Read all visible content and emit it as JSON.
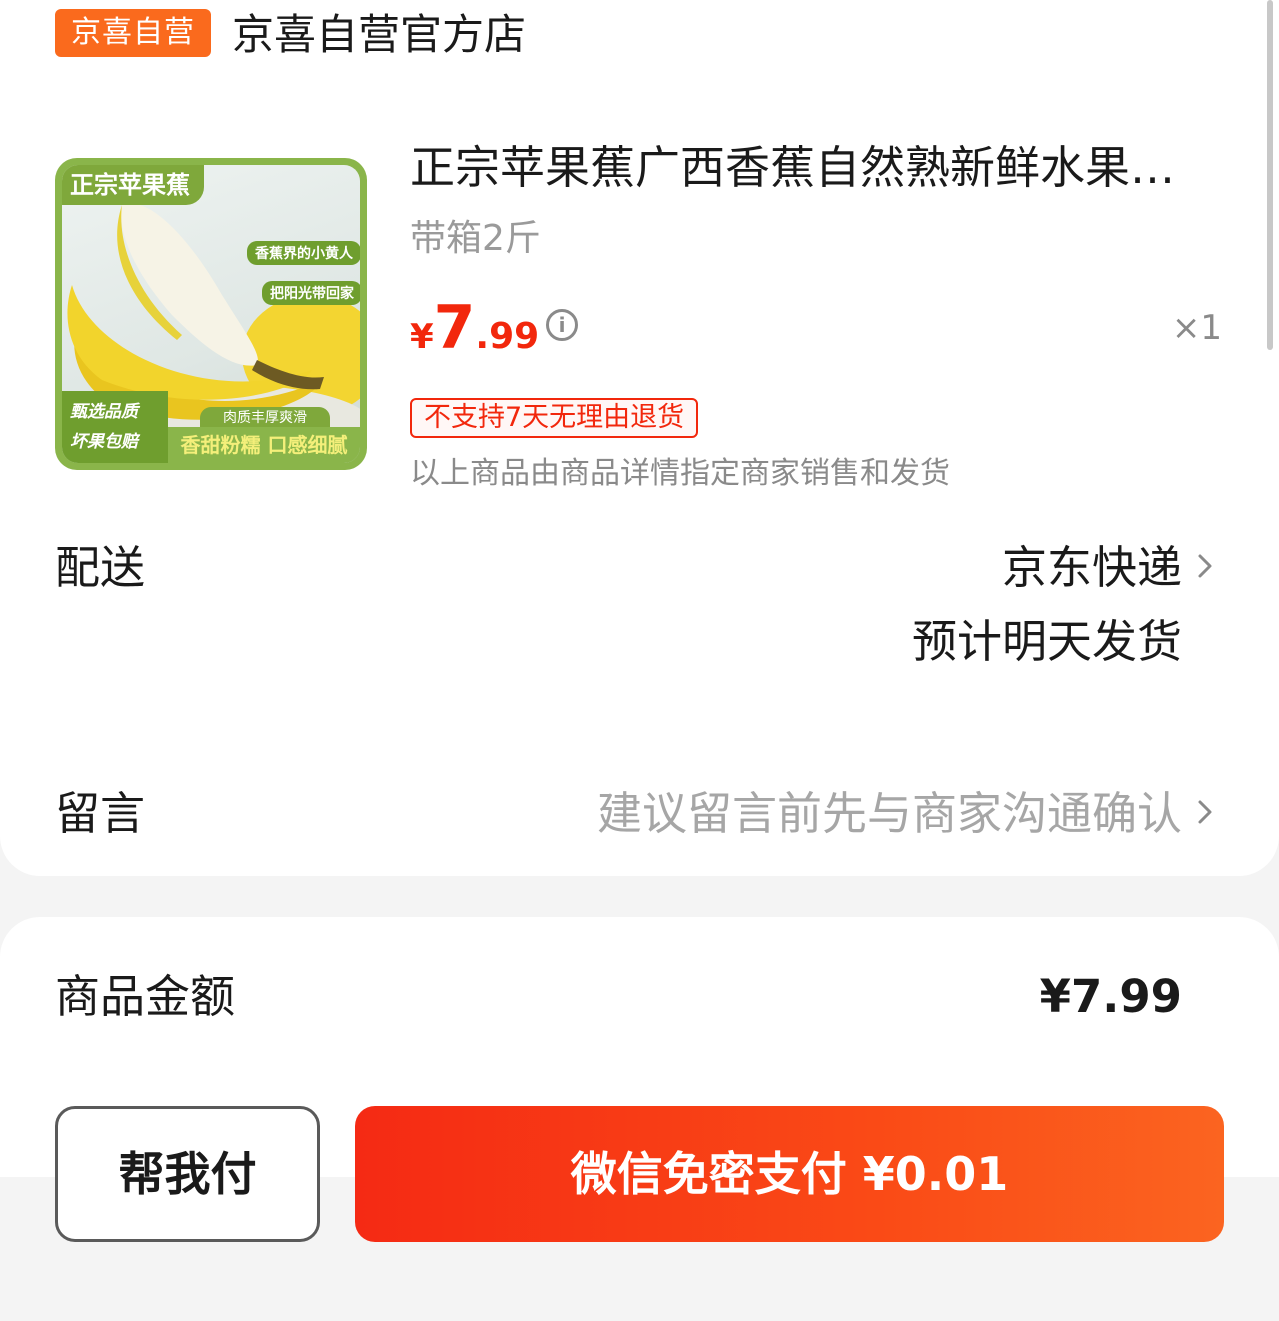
{
  "store": {
    "badge": "京喜自营",
    "name": "京喜自营官方店"
  },
  "product": {
    "image": {
      "banner": "正宗苹果蕉",
      "tag1": "香蕉界的小黄人",
      "tag2": "把阳光带回家",
      "left_line1": "甄选品质",
      "left_line2": "坏果包赔",
      "bottom_pill": "肉质丰厚爽滑",
      "bottom_text": "香甜粉糯 口感细腻"
    },
    "title": "正宗苹果蕉广西香蕉自然熟新鲜水果…",
    "spec": "带箱2斤",
    "price_currency": "¥",
    "price_int": "7",
    "price_dec": ".99",
    "quantity": "×1",
    "return_policy": "不支持7天无理由退货",
    "seller_note": "以上商品由商品详情指定商家销售和发货"
  },
  "delivery": {
    "label": "配送",
    "method": "京东快递",
    "eta": "预计明天发货"
  },
  "message": {
    "label": "留言",
    "placeholder": "建议留言前先与商家沟通确认"
  },
  "summary": {
    "goods_amount_label": "商品金额",
    "goods_amount_value": "¥7.99"
  },
  "actions": {
    "help_pay": "帮我付",
    "pay": "微信免密支付 ¥0.01"
  },
  "colors": {
    "accent": "#f2270c",
    "badge": "#fa6a1d"
  }
}
